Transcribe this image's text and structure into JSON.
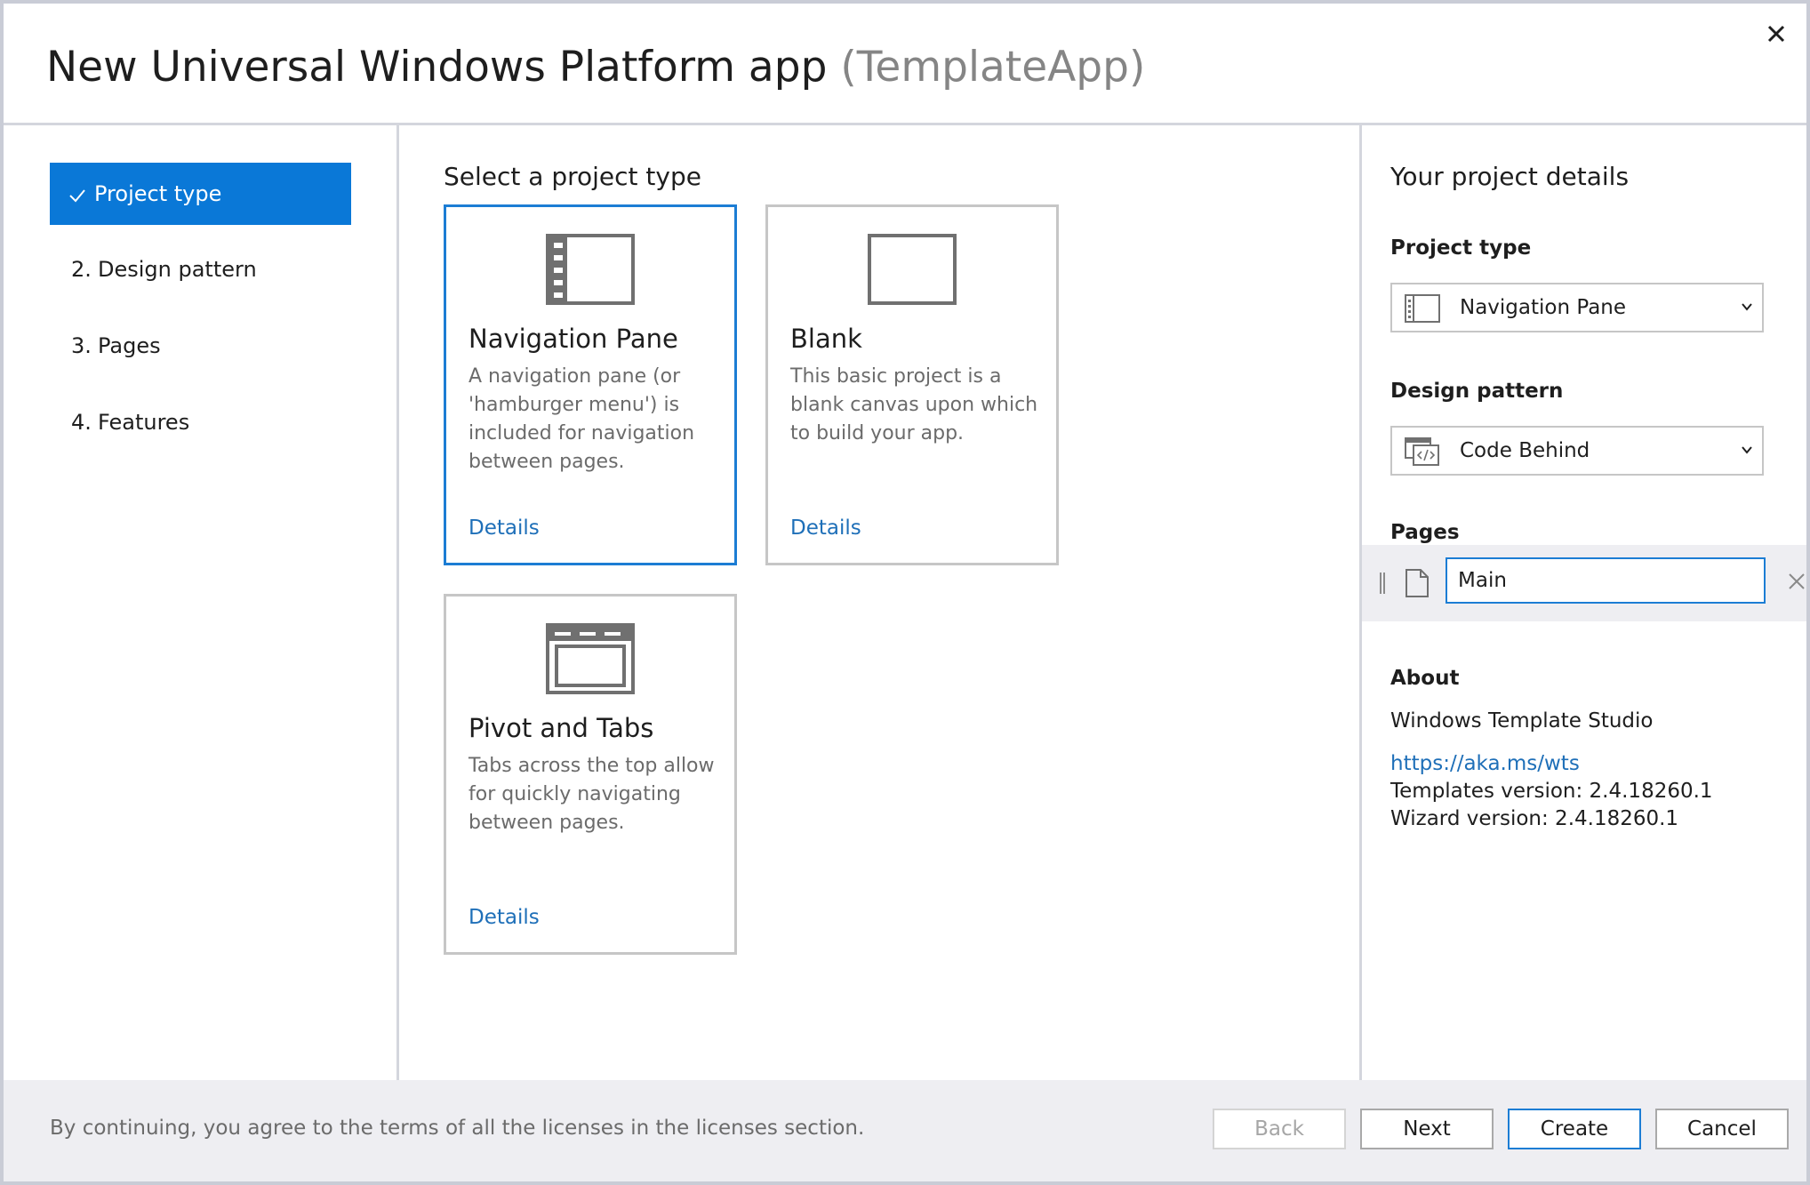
{
  "header": {
    "title": "New Universal Windows Platform app",
    "subtitle": "(TemplateApp)",
    "close_icon": "close-icon"
  },
  "steps": [
    {
      "number": "",
      "label": "Project type",
      "active": true
    },
    {
      "number": "2.",
      "label": "Design pattern",
      "active": false
    },
    {
      "number": "3.",
      "label": "Pages",
      "active": false
    },
    {
      "number": "4.",
      "label": "Features",
      "active": false
    }
  ],
  "project_types": {
    "heading": "Select a project type",
    "cards": [
      {
        "title": "Navigation Pane",
        "description": "A navigation pane (or 'hamburger menu') is included for navigation between pages.",
        "link": "Details",
        "icon": "navigation-pane-icon",
        "selected": true
      },
      {
        "title": "Blank",
        "description": "This basic project is a blank canvas upon which to build your app.",
        "link": "Details",
        "icon": "blank-page-icon",
        "selected": false
      },
      {
        "title": "Pivot and Tabs",
        "description": "Tabs across the top allow for quickly navigating between pages.",
        "link": "Details",
        "icon": "pivot-tabs-icon",
        "selected": false
      }
    ]
  },
  "details": {
    "heading": "Your project details",
    "project_type_label": "Project type",
    "project_type_value": "Navigation Pane",
    "design_pattern_label": "Design pattern",
    "design_pattern_value": "Code Behind",
    "pages_label": "Pages",
    "pages": [
      {
        "name": "Main"
      }
    ],
    "about_label": "About",
    "about_name": "Windows Template Studio",
    "about_link": "https://aka.ms/wts",
    "templates_version": "Templates version: 2.4.18260.1",
    "wizard_version": "Wizard version: 2.4.18260.1"
  },
  "footer": {
    "terms": "By continuing, you agree to the terms of all the licenses in the licenses section.",
    "back_label": "Back",
    "next_label": "Next",
    "create_label": "Create",
    "cancel_label": "Cancel"
  },
  "colors": {
    "accent": "#0a78d7",
    "link": "#1e6fb8",
    "footer_bg": "#eeeef2"
  }
}
